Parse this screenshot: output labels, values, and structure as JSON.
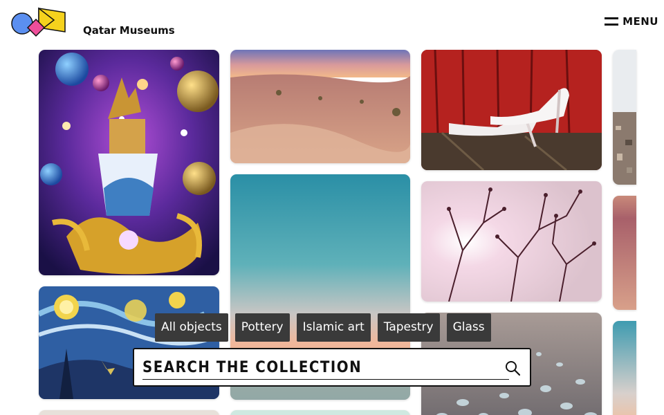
{
  "header": {
    "brand": "Qatar Museums",
    "menu_label": "MENU",
    "logo_colors": [
      "#5b8ff0",
      "#ee4f9a",
      "#f5d21d"
    ]
  },
  "gallery": [
    {
      "name": "artwork-cosmic-teacup",
      "description": "psychedelic cosmic collage"
    },
    {
      "name": "artwork-desert-dunes-dusk"
    },
    {
      "name": "artwork-white-heels"
    },
    {
      "name": "artwork-city-aerial"
    },
    {
      "name": "artwork-starry-night"
    },
    {
      "name": "artwork-gradient-sky"
    },
    {
      "name": "artwork-branches-silhouette"
    },
    {
      "name": "artwork-desert-dunes"
    },
    {
      "name": "artwork-water-droplets"
    },
    {
      "name": "artwork-teal-sky"
    }
  ],
  "filters": [
    "All objects",
    "Pottery",
    "Islamic art",
    "Tapestry",
    "Glass"
  ],
  "search": {
    "placeholder": "SEARCH THE COLLECTION"
  }
}
